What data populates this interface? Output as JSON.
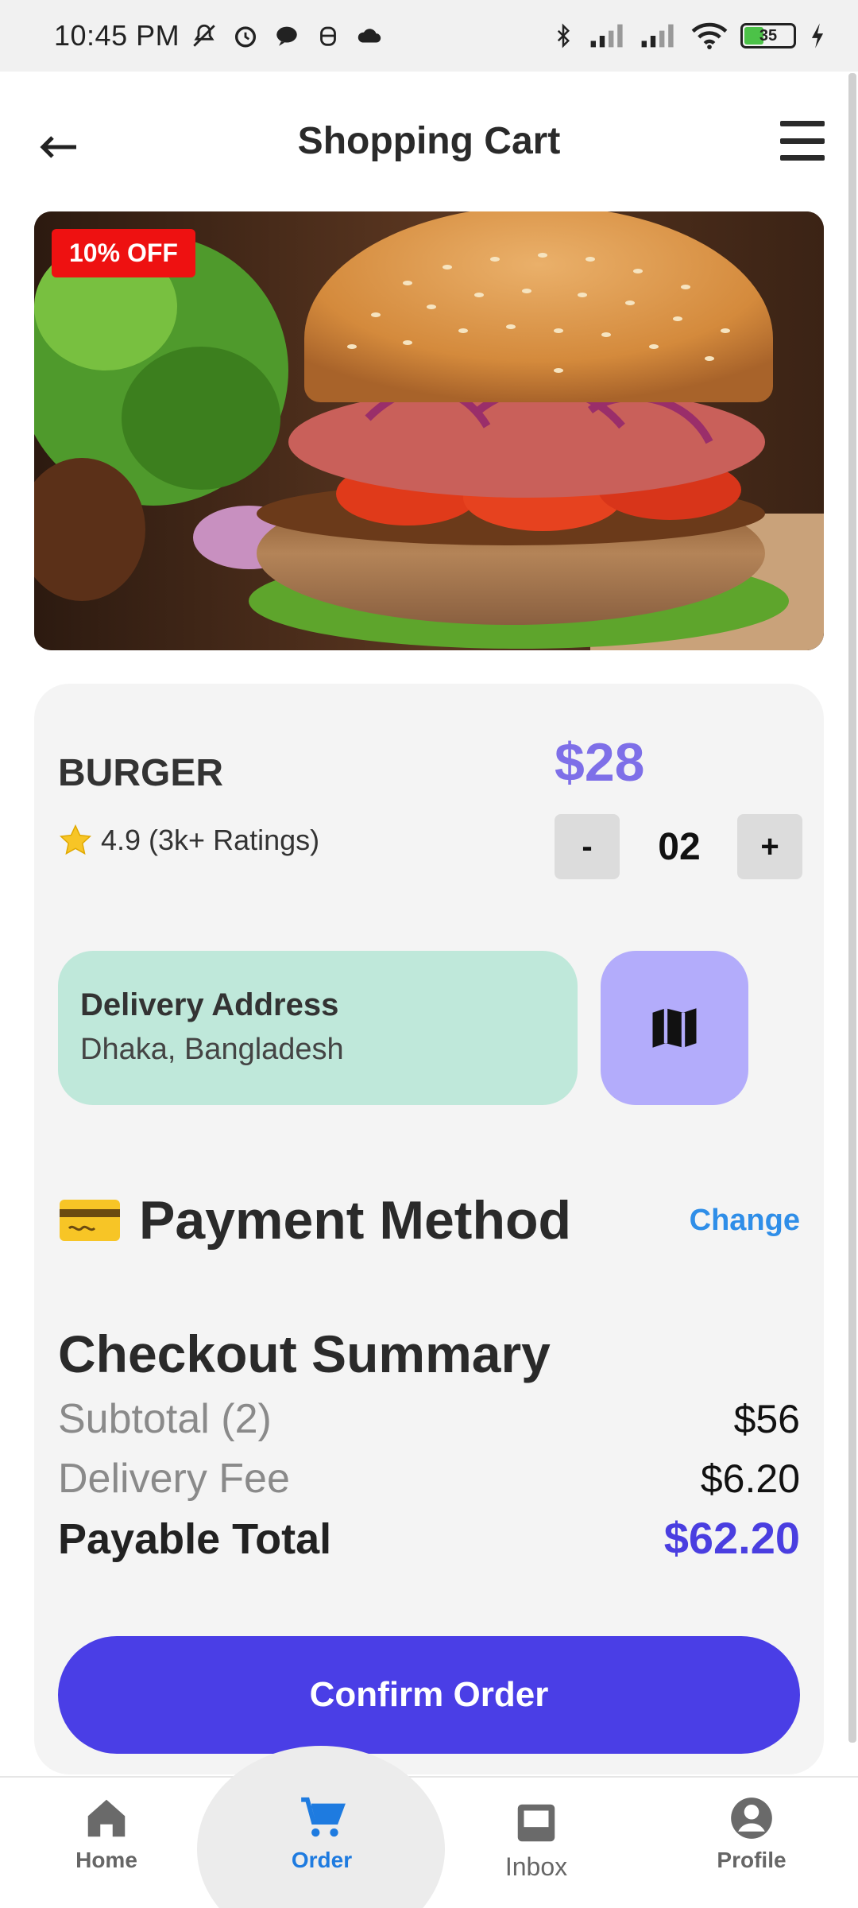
{
  "status_bar": {
    "time": "10:45 PM",
    "battery_level": "35",
    "icons_left": [
      "mute-icon",
      "alarm-icon",
      "chat-icon",
      "assistant-icon",
      "cloud-icon"
    ],
    "icons_right": [
      "bluetooth-icon",
      "signal-icon",
      "signal-icon",
      "wifi-icon",
      "battery-icon",
      "charging-icon"
    ]
  },
  "header": {
    "title": "Shopping Cart",
    "back_icon": "arrow-left-icon",
    "menu_icon": "hamburger-menu-icon"
  },
  "hero": {
    "badge": "10% OFF",
    "image": "burger-photo"
  },
  "product": {
    "name": "BURGER",
    "rating": "4.9 (3k+ Ratings)",
    "price": "$28",
    "qty_minus": "-",
    "qty_value": "02",
    "qty_plus": "+"
  },
  "delivery": {
    "title": "Delivery Address",
    "value": "Dhaka, Bangladesh",
    "map_icon": "map-icon"
  },
  "payment": {
    "title": "Payment Method",
    "change_label": "Change",
    "icon": "credit-card-icon"
  },
  "summary": {
    "title": "Checkout Summary",
    "subtotal_label": "Subtotal (2)",
    "subtotal_value": "$56",
    "delivery_label": "Delivery Fee",
    "delivery_value": "$6.20",
    "total_label": "Payable Total",
    "total_value": "$62.20"
  },
  "confirm_label": "Confirm Order",
  "bottom_nav": {
    "home": "Home",
    "order": "Order",
    "inbox": "Inbox",
    "profile": "Profile",
    "active": "Order"
  },
  "colors": {
    "accent": "#4a3ee6",
    "price": "#7e6fe8",
    "address_bg": "#bfe8da",
    "map_bg": "#b3acfb",
    "badge": "#ee1111",
    "link": "#2f8ee8"
  }
}
